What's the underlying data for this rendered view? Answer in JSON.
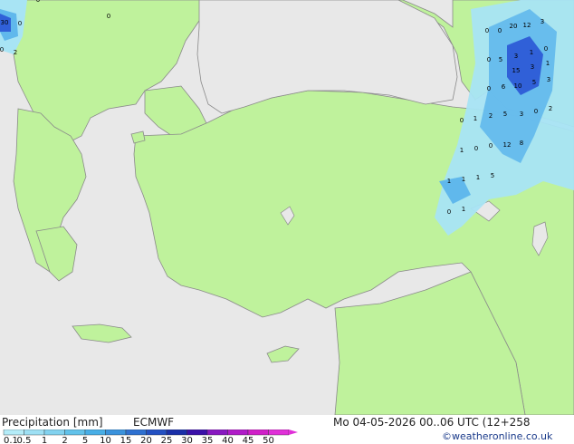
{
  "footer": {
    "title": "Precipitation [mm]",
    "model": "ECMWF",
    "datetime": "Mo 04-05-2026 00..06 UTC (12+258",
    "credit": "©weatheronline.co.uk"
  },
  "legend": {
    "ticks": [
      "0.1",
      "0.5",
      "1",
      "2",
      "5",
      "10",
      "15",
      "20",
      "25",
      "30",
      "35",
      "40",
      "45",
      "50"
    ],
    "colors": [
      "#b4ecf8",
      "#9ee0f4",
      "#82d2ef",
      "#62c2ea",
      "#48aee6",
      "#3a92dc",
      "#2e70d0",
      "#2350c2",
      "#1a2fa8",
      "#3a10a8",
      "#8818c0",
      "#b01cc8",
      "#d020c8",
      "#e030d8"
    ]
  },
  "map": {
    "colors": {
      "sea": "#e8e8e8",
      "land": "#bff29c",
      "coast": "#8a8a8a",
      "precip_light": "#a8e4f4",
      "precip_mid": "#60b8ec",
      "precip_heavy": "#3060d8"
    },
    "precip_labels": [
      "30",
      "0",
      "0",
      "2",
      "0",
      "0",
      "0",
      "20",
      "12",
      "3",
      "0",
      "5",
      "3",
      "1",
      "0",
      "15",
      "3",
      "1",
      "0",
      "6",
      "10",
      "5",
      "3",
      "0",
      "1",
      "2",
      "5",
      "3",
      "0",
      "2",
      "1",
      "0",
      "0",
      "12",
      "8",
      "1",
      "1",
      "1",
      "5",
      "0",
      "1",
      "0"
    ]
  }
}
